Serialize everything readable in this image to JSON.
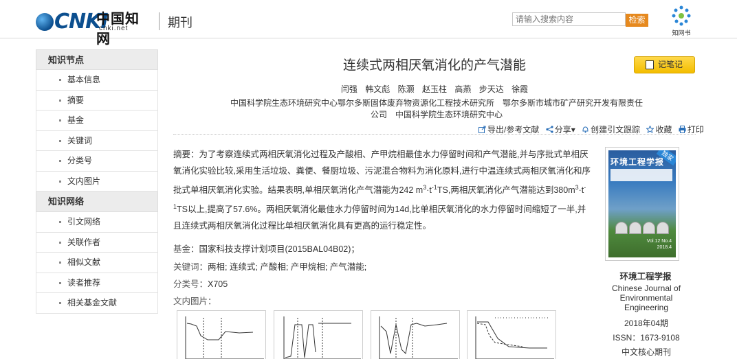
{
  "header": {
    "logo_text": "CNKI",
    "logo_cn": "中国知网",
    "logo_url": "cnki.net",
    "section": "期刊",
    "search_placeholder": "请输入搜索内容",
    "search_button": "检索",
    "zhiwangshu_label": "知网书"
  },
  "sidebar": {
    "group1": {
      "title": "知识节点",
      "items": [
        "基本信息",
        "摘要",
        "基金",
        "关键词",
        "分类号",
        "文内图片"
      ]
    },
    "group2": {
      "title": "知识网络",
      "items": [
        "引文网络",
        "关联作者",
        "相似文献",
        "读者推荐",
        "相关基金文献"
      ]
    }
  },
  "article": {
    "title": "连续式两相厌氧消化的产气潜能",
    "note_button": "记笔记",
    "authors": [
      "闫强",
      "韩文彪",
      "陈灏",
      "赵玉柱",
      "高燕",
      "步天达",
      "徐霞"
    ],
    "orgs_line1": "中国科学院生态环境研究中心鄂尔多斯固体废弃物资源化工程技术研究所　鄂尔多斯市城市矿产研究开发有限责任",
    "orgs_line2": "公司　中国科学院生态环境研究中心",
    "toolbar": {
      "export": "导出/参考文献",
      "share": "分享",
      "track": "创建引文跟踪",
      "favorite": "收藏",
      "print": "打印"
    },
    "abstract_label": "摘要：",
    "abstract_p1": "为了考察连续式两相厌氧消化过程及产酸相、产甲烷相最佳水力停留时间和产气潜能,并与序批式单相厌氧消化实验比较,采用生活垃圾、粪便、餐厨垃圾、污泥混合物料为消化原料,进行中温连续式两相厌氧消化和序批式单相厌氧消化实验。结果表明,单相厌氧消化产气潜能为242 m",
    "abstract_p2": "TS,两相厌氧消化产气潜能达到380m",
    "abstract_p3": "TS以上,提高了57.6%。两相厌氧消化最佳水力停留时间为14d,比单相厌氧消化的水力停留时间缩短了一半,并且连续式两相厌氧消化过程比单相厌氧消化具有更高的运行稳定性。",
    "unit_sup3": "3",
    "unit_t": "·t",
    "unit_sup_neg1": "-1",
    "fund_label": "基金：",
    "fund_value": "国家科技支撑计划项目(2015BAL04B02)；",
    "keywords_label": "关键词：",
    "keywords_value": "两相; 连续式; 产酸相; 产甲烷相; 产气潜能;",
    "class_label": "分类号：",
    "class_value": "X705",
    "figures_label": "文内图片："
  },
  "journal": {
    "cover_title": "环境工程学报",
    "cover_tag": "独家",
    "cover_vol": "Vol.12 No.4\n2018.4",
    "name_cn": "环境工程学报",
    "name_en": "Chinese Journal of Environmental Engineering",
    "issue": "2018年04期",
    "issn": "ISSN：1673-9108",
    "core": "中文核心期刊"
  }
}
